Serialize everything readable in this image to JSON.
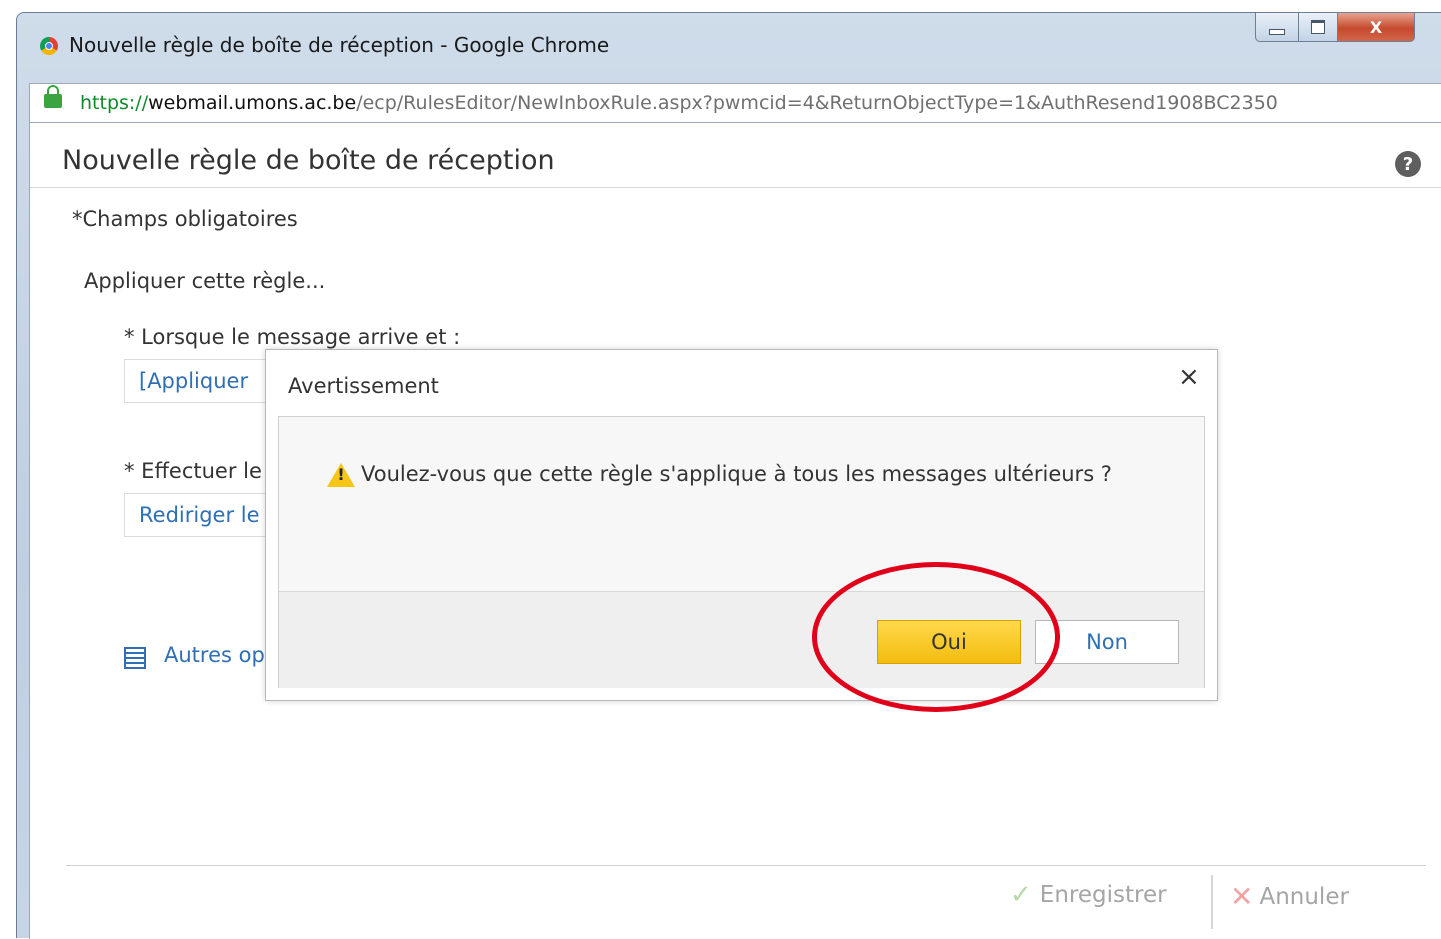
{
  "window": {
    "title": "Nouvelle règle de boîte de réception - Google Chrome",
    "close_label": "X"
  },
  "address_bar": {
    "scheme": "https://",
    "host": "webmail.umons.ac.be",
    "path": "/ecp/RulesEditor/NewInboxRule.aspx?pwmcid=4&ReturnObjectType=1&AuthResend1908BC2350"
  },
  "page": {
    "title": "Nouvelle règle de boîte de réception",
    "help_label": "?",
    "required_note": "*Champs obligatoires",
    "apply_label": "Appliquer cette règle...",
    "condition_label": "* Lorsque le message arrive et :",
    "condition_link": "[Appliquer",
    "action_label": "* Effectuer le",
    "action_link": "Rediriger le",
    "more_options": "Autres op",
    "save_label": "Enregistrer",
    "cancel_label": "Annuler"
  },
  "dialog": {
    "title": "Avertissement",
    "close_glyph": "×",
    "message": "Voulez-vous que cette règle s'applique à tous les messages ultérieurs ?",
    "yes_label": "Oui",
    "no_label": "Non"
  },
  "icons": {
    "browser": "chrome-icon",
    "lock": "lock-icon",
    "help": "help-icon",
    "warning": "warning-icon",
    "options": "list-icon",
    "save": "check-icon",
    "cancel": "x-icon"
  },
  "colors": {
    "accent_button": "#f3bd0f",
    "link": "#2f6fb3",
    "highlight_ring": "#e0001a",
    "secure_scheme": "#0f8a2a"
  }
}
